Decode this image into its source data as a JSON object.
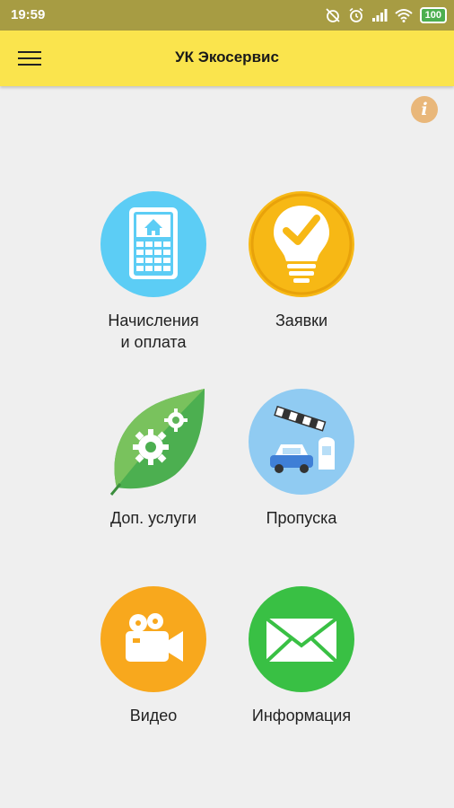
{
  "status_bar": {
    "time": "19:59",
    "battery": "100",
    "icons": [
      "alarm-off-icon",
      "alarm-icon",
      "signal-icon",
      "wifi-icon",
      "battery-icon"
    ]
  },
  "app_bar": {
    "title": "УК Экосервис",
    "menu_icon": "hamburger-menu-icon",
    "background": "#fae44d"
  },
  "info_button": {
    "icon": "info-icon",
    "color": "#e9b77a"
  },
  "tiles": [
    {
      "label": "Начисления\nи оплата",
      "icon": "calculator-house-icon",
      "color": "#5ccdf5"
    },
    {
      "label": "Заявки",
      "icon": "lightbulb-check-icon",
      "color": "#f7b815"
    },
    {
      "label": "Доп. услуги",
      "icon": "leaf-gears-icon",
      "color": "#4caf50"
    },
    {
      "label": "Пропуска",
      "icon": "barrier-car-icon",
      "color": "#90cbf2"
    },
    {
      "label": "Видео",
      "icon": "video-camera-icon",
      "color": "#f8a81d"
    },
    {
      "label": "Информация",
      "icon": "envelope-icon",
      "color": "#39c044"
    }
  ]
}
